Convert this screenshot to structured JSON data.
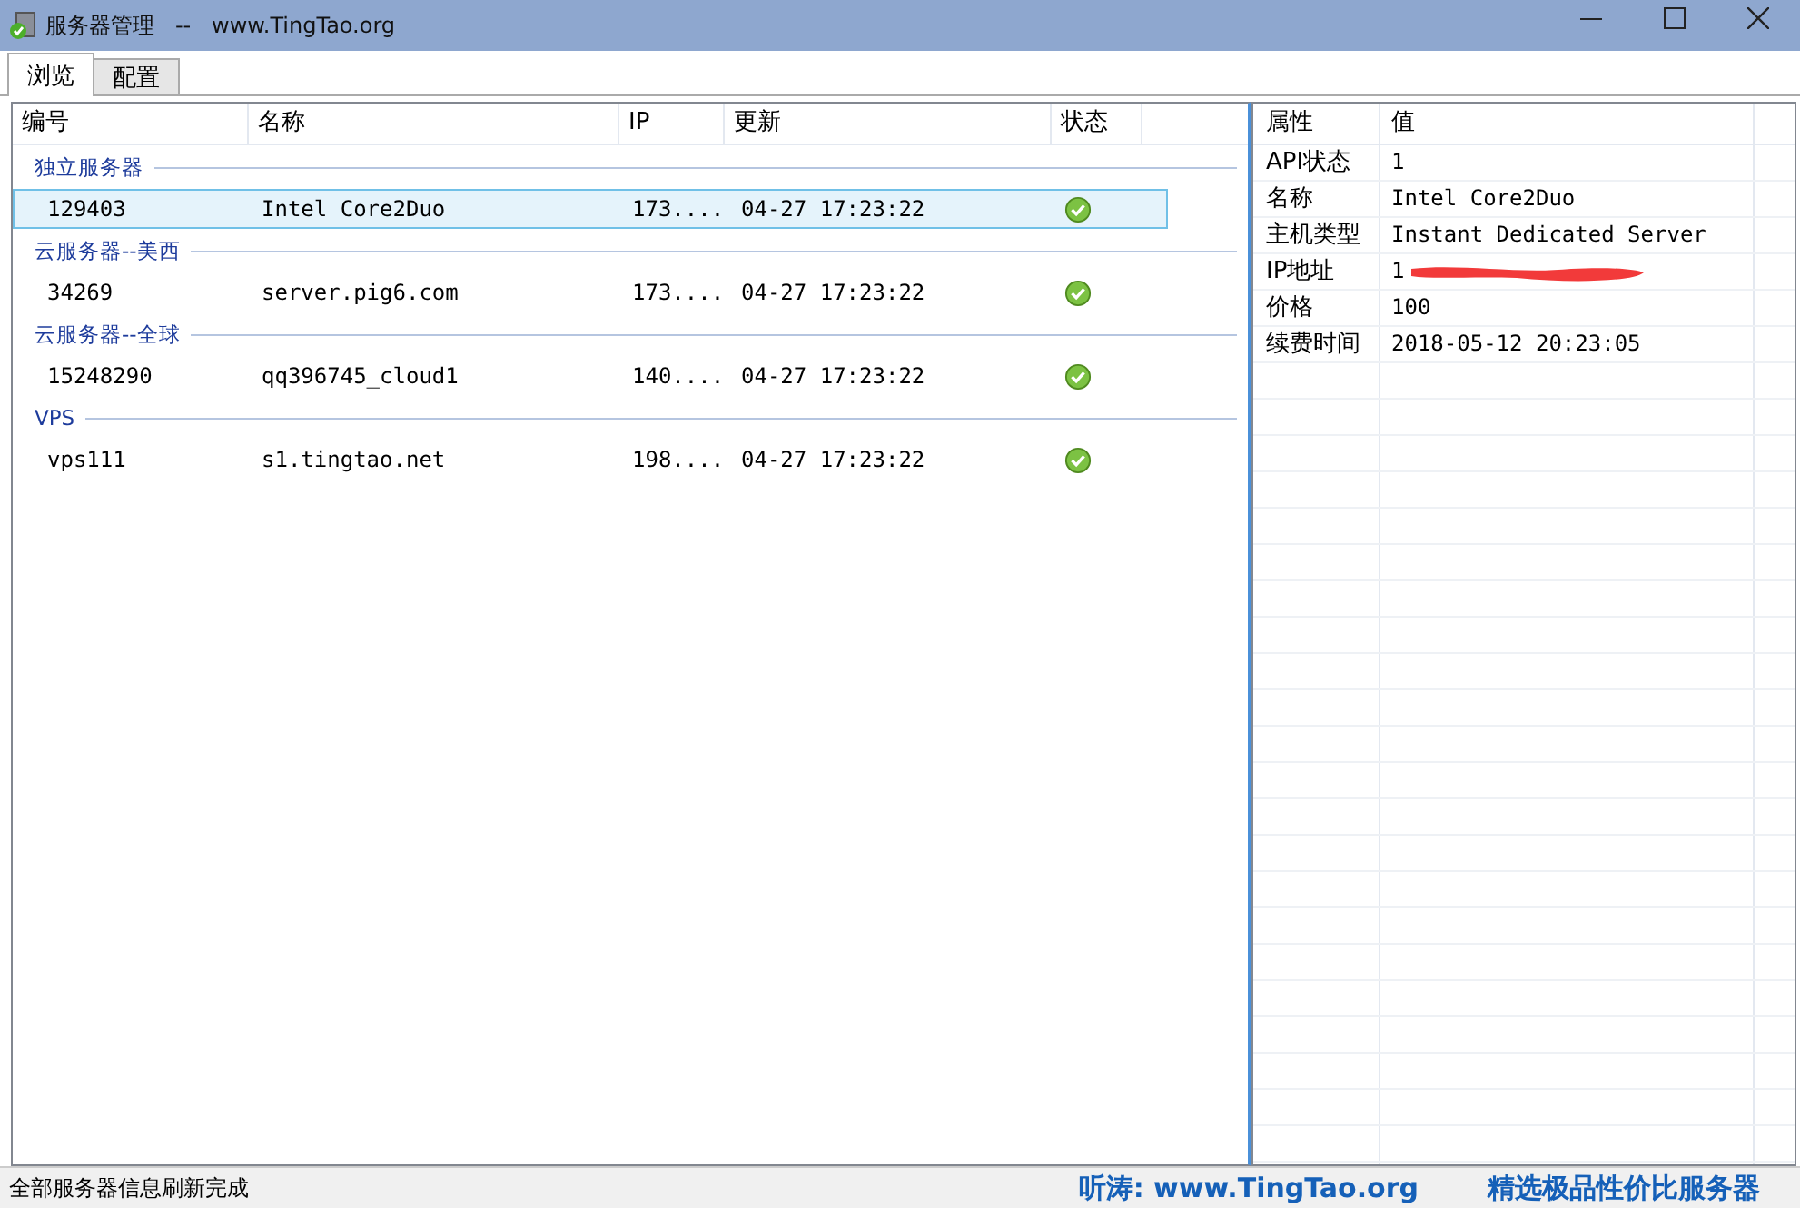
{
  "window": {
    "title": "服务器管理   --   www.TingTao.org"
  },
  "tabs": [
    {
      "label": "浏览",
      "selected": true
    },
    {
      "label": "配置",
      "selected": false
    }
  ],
  "server_list": {
    "columns": [
      "编号",
      "名称",
      "IP",
      "更新",
      "状态"
    ],
    "groups": [
      {
        "name": "独立服务器",
        "rows": [
          {
            "id": "129403",
            "name": "Intel Core2Duo",
            "ip": "173....",
            "updated": "04-27 17:23:22",
            "selected": true
          }
        ]
      },
      {
        "name": "云服务器--美西",
        "rows": [
          {
            "id": "34269",
            "name": "server.pig6.com",
            "ip": "173....",
            "updated": "04-27 17:23:22",
            "selected": false
          }
        ]
      },
      {
        "name": "云服务器--全球",
        "rows": [
          {
            "id": "15248290",
            "name": "qq396745_cloud1",
            "ip": "140....",
            "updated": "04-27 17:23:22",
            "selected": false
          }
        ]
      },
      {
        "name": "VPS",
        "rows": [
          {
            "id": "vps111",
            "name": "s1.tingtao.net",
            "ip": "198....",
            "updated": "04-27 17:23:22",
            "selected": false
          }
        ]
      }
    ]
  },
  "properties": {
    "columns": [
      "属性",
      "值"
    ],
    "rows": [
      {
        "key": "API状态",
        "value": "1",
        "redacted": false
      },
      {
        "key": "名称",
        "value": "Intel Core2Duo",
        "redacted": false
      },
      {
        "key": "主机类型",
        "value": "Instant Dedicated Server",
        "redacted": false
      },
      {
        "key": "IP地址",
        "value": "1",
        "redacted": true
      },
      {
        "key": "价格",
        "value": "100",
        "redacted": false
      },
      {
        "key": "续费时间",
        "value": "2018-05-12 20:23:05",
        "redacted": false
      }
    ]
  },
  "status_bar": {
    "message": "全部服务器信息刷新完成",
    "site": "听涛: www.TingTao.org",
    "slogan": "精选极品性价比服务器"
  }
}
